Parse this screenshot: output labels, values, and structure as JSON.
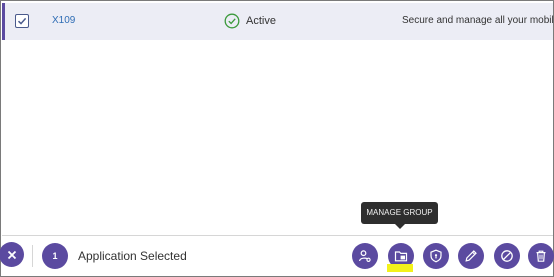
{
  "row": {
    "app_id": "X109",
    "status": "Active",
    "description": "Secure and manage all your mobile ..."
  },
  "tooltip": {
    "text": "MANAGE GROUP"
  },
  "bottombar": {
    "selected_count": "1",
    "selected_label": "Application Selected",
    "actions": [
      {
        "icon": "user-settings-icon"
      },
      {
        "icon": "folder-group-icon"
      },
      {
        "icon": "shield-icon"
      },
      {
        "icon": "pencil-icon"
      },
      {
        "icon": "block-icon"
      },
      {
        "icon": "trash-icon"
      }
    ]
  },
  "colors": {
    "accent": "#5b4aa0",
    "row_background": "#ecedf5",
    "link": "#2f6db5",
    "status_ok": "#3c9a3c",
    "highlight": "#f3f21a",
    "tooltip_bg": "#2e2e2e"
  }
}
